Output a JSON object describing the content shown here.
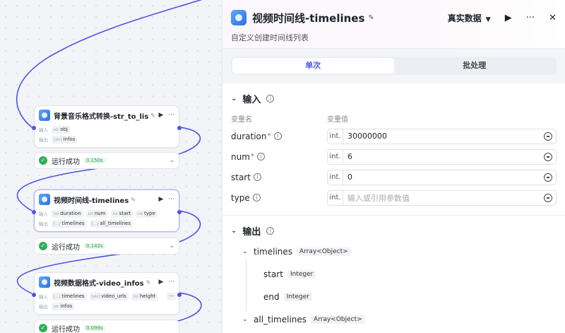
{
  "canvas": {
    "nodes": [
      {
        "title": "背景音乐格式转换-str_to_lis",
        "input_label": "输入",
        "inputs": [
          {
            "type": "str",
            "name": "obj"
          }
        ],
        "output_label": "输出",
        "outputs": [
          {
            "type": "[str]",
            "name": "infos"
          }
        ],
        "status": "运行成功",
        "time": "0.150s"
      },
      {
        "title": "视频时间线-timelines",
        "input_label": "输入",
        "inputs": [
          {
            "type": "int",
            "name": "duration"
          },
          {
            "type": "int",
            "name": "num"
          },
          {
            "type": "int",
            "name": "start"
          },
          {
            "type": "int",
            "name": "type"
          }
        ],
        "output_label": "输出",
        "outputs": [
          {
            "type": "[...]",
            "name": "timelines"
          },
          {
            "type": "[...]",
            "name": "all_timelines"
          }
        ],
        "status": "运行成功",
        "time": "0.142s"
      },
      {
        "title": "视频数据格式-video_infos",
        "input_label": "输入",
        "inputs": [
          {
            "type": "[...]",
            "name": "timelines"
          },
          {
            "type": "[str]",
            "name": "video_urls"
          },
          {
            "type": "int",
            "name": "height"
          }
        ],
        "more": "···",
        "output_label": "输出",
        "outputs": [
          {
            "type": "str",
            "name": "infos"
          }
        ],
        "status": "运行成功",
        "time": "0.099s"
      }
    ],
    "colors": {
      "port": "#4d53e8",
      "success": "#2fae5a"
    }
  },
  "panel": {
    "title": "视频时间线-timelines",
    "description": "自定义创建时间线列表",
    "data_source": "真实数据",
    "tabs": [
      "单次",
      "批处理"
    ],
    "input": {
      "title": "输入",
      "col_name": "变量名",
      "col_value": "变量值",
      "params": [
        {
          "name": "duration",
          "required": true,
          "type": "int.",
          "value": "30000000",
          "placeholder": ""
        },
        {
          "name": "num",
          "required": true,
          "type": "int.",
          "value": "6",
          "placeholder": ""
        },
        {
          "name": "start",
          "required": false,
          "type": "int.",
          "value": "0",
          "placeholder": ""
        },
        {
          "name": "type",
          "required": false,
          "type": "int.",
          "value": "",
          "placeholder": "输入或引用参数值"
        }
      ]
    },
    "output": {
      "title": "输出",
      "fields": [
        {
          "name": "timelines",
          "type": "Array<Object>",
          "children": [
            {
              "name": "start",
              "type": "Integer"
            },
            {
              "name": "end",
              "type": "Integer"
            }
          ]
        },
        {
          "name": "all_timelines",
          "type": "Array<Object>"
        }
      ]
    },
    "colors": {
      "accent": "#4d53e8",
      "required": "#e5484d"
    }
  }
}
